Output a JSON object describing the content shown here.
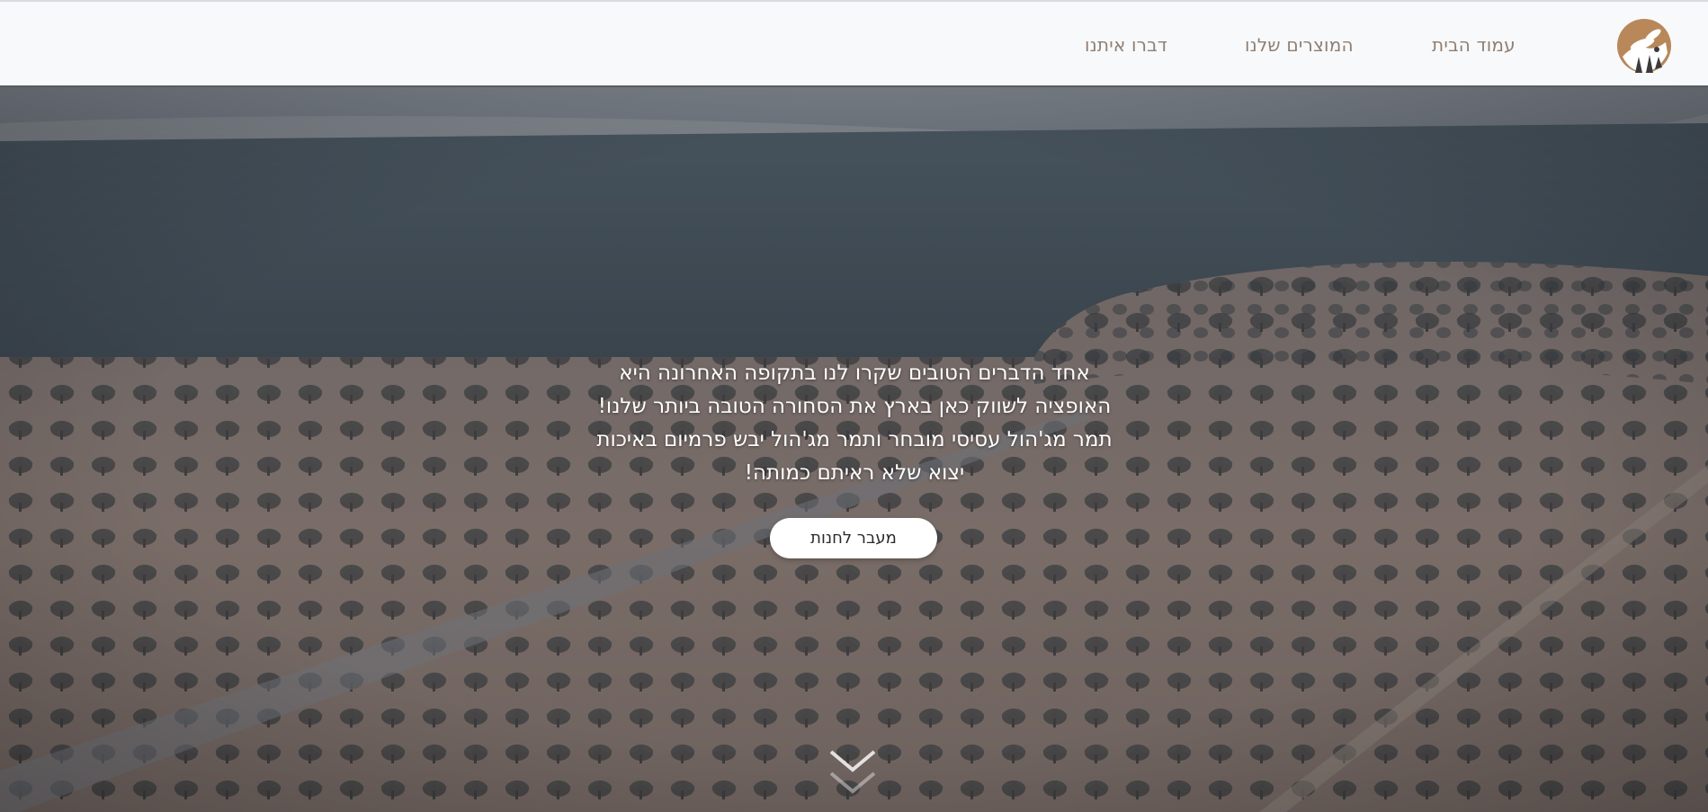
{
  "header": {
    "logo_icon": "palm-leaf-logo-icon",
    "nav": {
      "home": "עמוד הבית",
      "products": "המוצרים שלנו",
      "contact": "דברו איתנו"
    }
  },
  "hero": {
    "lines": [
      "אחד הדברים הטובים שקרו לנו בתקופה האחרונה היא",
      "האופציה לשווק כאן בארץ את הסחורה הטובה ביותר שלנו!",
      "תמר מג'הול עסיסי מובחר ותמר מג'הול יבש פרמיום באיכות",
      "יצוא שלא ראיתם כמותה!"
    ],
    "cta_label": "מעבר לחנות",
    "scroll_icon": "chevron-down-icon"
  },
  "colors": {
    "nav_text": "#8f7f72",
    "logo_brown": "#b8885a",
    "header_bg": "#f8f9fb"
  }
}
